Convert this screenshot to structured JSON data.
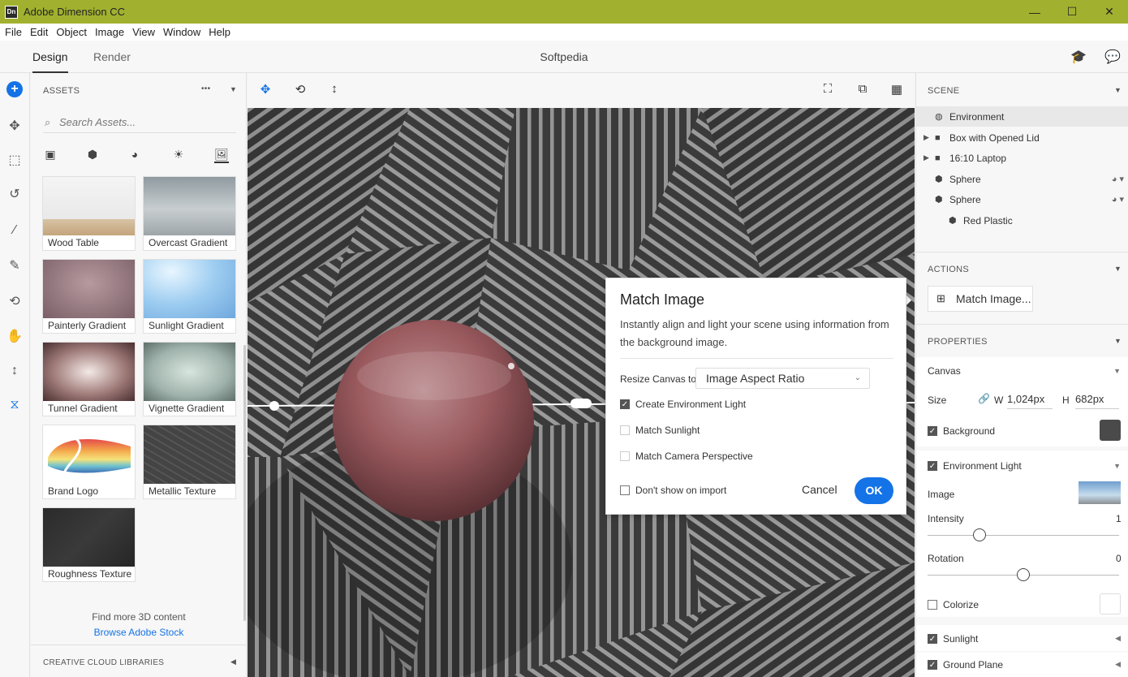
{
  "app": {
    "title": "Adobe Dimension CC",
    "icon_text": "Dn"
  },
  "window_controls": {
    "minimize": "—",
    "maximize": "☐",
    "close": "✕"
  },
  "menu": [
    "File",
    "Edit",
    "Object",
    "Image",
    "View",
    "Window",
    "Help"
  ],
  "tabs": {
    "design": "Design",
    "render": "Render"
  },
  "document_title": "Softpedia",
  "assets": {
    "header": "ASSETS",
    "more": "•••",
    "search_placeholder": "Search Assets...",
    "items": [
      {
        "label": "Wood Table"
      },
      {
        "label": "Overcast Gradient"
      },
      {
        "label": "Painterly Gradient"
      },
      {
        "label": "Sunlight Gradient"
      },
      {
        "label": "Tunnel Gradient"
      },
      {
        "label": "Vignette Gradient"
      },
      {
        "label": "Brand Logo"
      },
      {
        "label": "Metallic Texture"
      },
      {
        "label": "Roughness Texture"
      }
    ],
    "find_more": "Find more 3D content",
    "browse_link": "Browse Adobe Stock",
    "libraries_header": "CREATIVE CLOUD LIBRARIES"
  },
  "dialog": {
    "title": "Match Image",
    "description": "Instantly align and light your scene using information from the background image.",
    "resize_label": "Resize Canvas to",
    "resize_value": "Image Aspect Ratio",
    "create_env_light": "Create Environment Light",
    "match_sunlight": "Match Sunlight",
    "match_camera": "Match Camera Perspective",
    "dont_show": "Don't show on import",
    "cancel": "Cancel",
    "ok": "OK"
  },
  "scene": {
    "header": "SCENE",
    "items": [
      {
        "label": "Environment"
      },
      {
        "label": "Box with Opened Lid"
      },
      {
        "label": "16:10 Laptop"
      },
      {
        "label": "Sphere"
      },
      {
        "label": "Sphere"
      },
      {
        "label": "Red Plastic"
      }
    ]
  },
  "actions": {
    "header": "ACTIONS",
    "match_image": "Match Image..."
  },
  "properties": {
    "header": "PROPERTIES",
    "canvas_label": "Canvas",
    "size_label": "Size",
    "w_label": "W",
    "w_value": "1,024px",
    "h_label": "H",
    "h_value": "682px",
    "background_label": "Background",
    "background_color": "#4a4a4a",
    "env_light_label": "Environment Light",
    "image_label": "Image",
    "intensity_label": "Intensity",
    "intensity_value": "1",
    "intensity_level": 0.27,
    "rotation_label": "Rotation",
    "rotation_value": "0",
    "rotation_level": 0.5,
    "colorize_label": "Colorize",
    "sunlight_label": "Sunlight",
    "ground_plane_label": "Ground Plane"
  },
  "colors": {
    "accent": "#1473e6",
    "titlebar": "#a1b12f"
  }
}
